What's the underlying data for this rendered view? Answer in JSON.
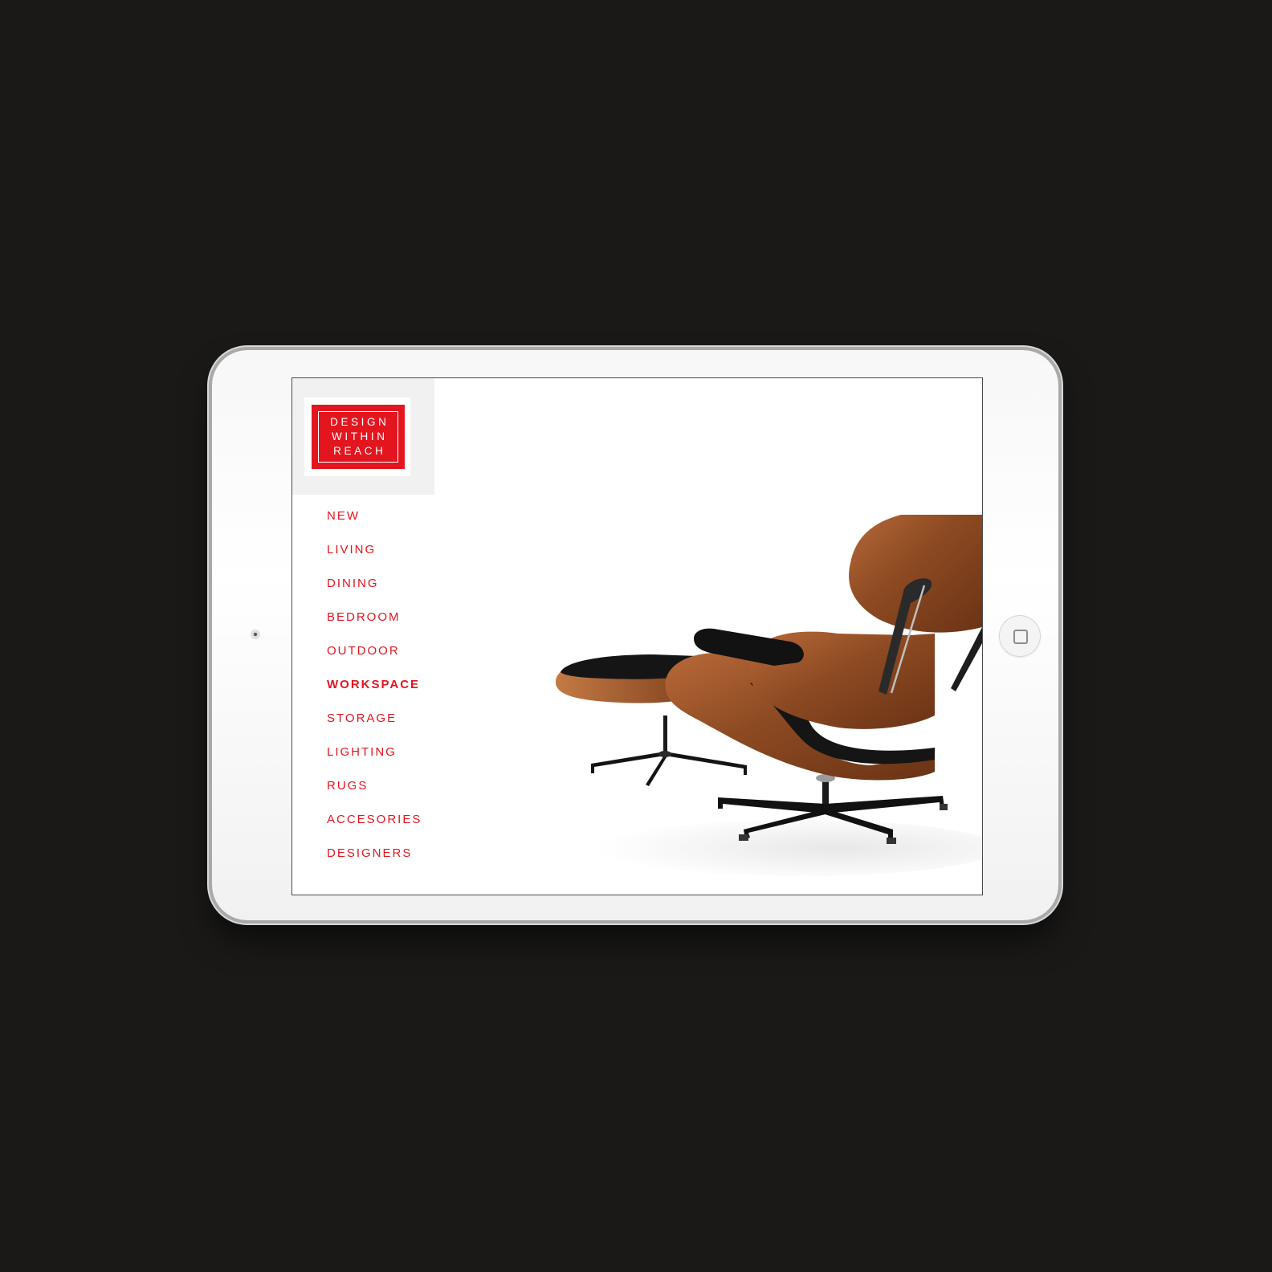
{
  "brand": {
    "logo_lines": [
      "DESIGN",
      "WITHIN",
      "REACH"
    ],
    "accent_color": "#e3151f"
  },
  "nav": {
    "items": [
      {
        "label": "NEW",
        "active": false
      },
      {
        "label": "LIVING",
        "active": false
      },
      {
        "label": "DINING",
        "active": false
      },
      {
        "label": "BEDROOM",
        "active": false
      },
      {
        "label": "OUTDOOR",
        "active": false
      },
      {
        "label": "WORKSPACE",
        "active": true
      },
      {
        "label": "STORAGE",
        "active": false
      },
      {
        "label": "LIGHTING",
        "active": false
      },
      {
        "label": "RUGS",
        "active": false
      },
      {
        "label": "ACCESORIES",
        "active": false
      },
      {
        "label": "DESIGNERS",
        "active": false
      }
    ]
  },
  "hero": {
    "icon": "lounge-chair-ottoman-illustration"
  },
  "device": {
    "home_icon": "home-button-icon",
    "camera_icon": "camera-icon"
  }
}
